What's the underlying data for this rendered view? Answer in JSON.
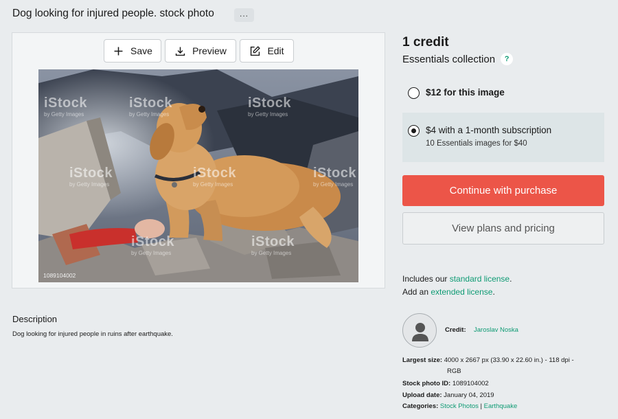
{
  "header": {
    "title": "Dog looking for injured people. stock photo",
    "more_label": "..."
  },
  "toolbar": {
    "save_label": "Save",
    "preview_label": "Preview",
    "edit_label": "Edit"
  },
  "photo": {
    "watermark": "iStock",
    "watermark_sub": "by Getty Images",
    "id_label": "1089104002"
  },
  "description": {
    "heading": "Description",
    "text": "Dog looking for injured people in ruins after earthquake."
  },
  "pricing": {
    "credit_title": "1 credit",
    "collection": "Essentials collection",
    "help_icon": "?",
    "option1_label": "$12 for this image",
    "option2_label": "$4 with a 1-month subscription",
    "option2_sub": "10 Essentials images for $40",
    "purchase_label": "Continue with purchase",
    "plans_label": "View plans and pricing"
  },
  "license": {
    "line1_prefix": "Includes our ",
    "line1_link": "standard license",
    "line1_suffix": ".",
    "line2_prefix": "Add an ",
    "line2_link": "extended license",
    "line2_suffix": "."
  },
  "credit": {
    "label": "Credit:",
    "name": "Jaroslav Noska"
  },
  "meta": {
    "size_label": "Largest size:",
    "size_value_line1": "4000 x 2667 px (33.90 x 22.60 in.) - 118 dpi -",
    "size_value_line2": "RGB",
    "id_label": "Stock photo ID:",
    "id_value": "1089104002",
    "date_label": "Upload date:",
    "date_value": "January 04, 2019",
    "categories_label": "Categories:",
    "category1": "Stock Photos",
    "category_sep": "|",
    "category2": "Earthquake"
  },
  "colors": {
    "accent_green": "#0f9b74",
    "purchase_red": "#ec5548",
    "background": "#e9ecee"
  },
  "icons": {
    "save": "plus-icon",
    "preview": "download-icon",
    "edit": "edit-icon",
    "avatar": "user-avatar-icon"
  }
}
